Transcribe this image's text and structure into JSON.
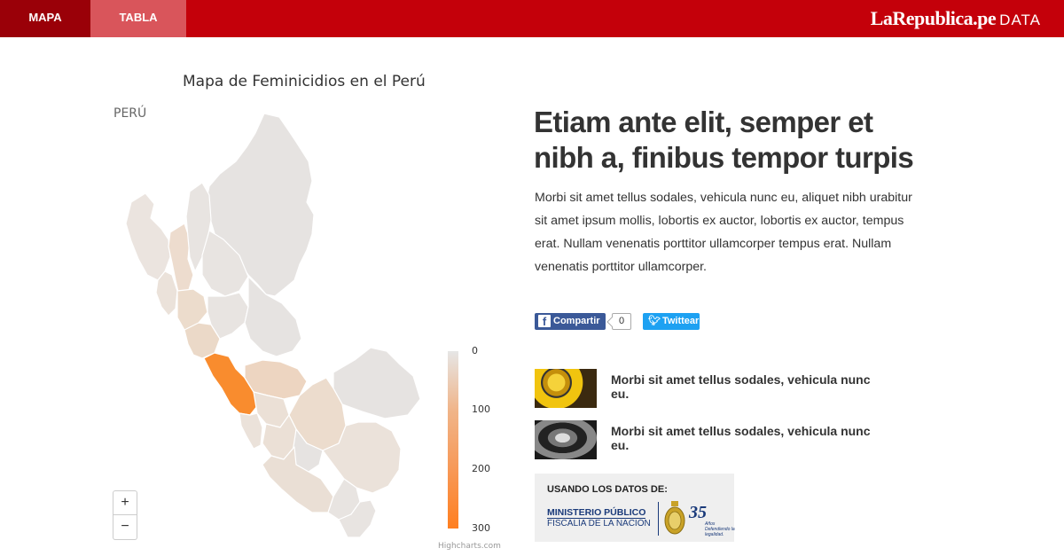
{
  "nav": {
    "tab_mapa": "MAPA",
    "tab_tabla": "TABLA",
    "brand": "LaRepublica.pe",
    "brand_suffix": "DATA"
  },
  "map": {
    "title": "Mapa de Feminicidios en el Perú",
    "subtitle": "PERÚ",
    "legend_ticks": [
      "0",
      "100",
      "200",
      "300"
    ],
    "legend_colors": {
      "min": "#e6e6e6",
      "max": "#ff7f20"
    },
    "highlight_color": "#f98c2e",
    "credits": "Highcharts.com",
    "zoom_in": "+",
    "zoom_out": "−"
  },
  "article": {
    "headline": "Etiam ante elit, semper et nibh a, finibus tempor turpis",
    "body": "Morbi sit amet tellus sodales, vehicula nunc eu, aliquet nibh urabitur sit amet ipsum mollis, lobortis ex auctor, lobortis ex auctor, tempus erat. Nullam venenatis porttitor ullamcorper tempus erat. Nullam venenatis porttitor ullamcorper."
  },
  "share": {
    "facebook_label": "Compartir",
    "facebook_count": "0",
    "twitter_label": "Twittear"
  },
  "related": [
    {
      "title": "Morbi sit amet tellus sodales, vehicula nunc eu."
    },
    {
      "title": "Morbi sit amet tellus sodales, vehicula nunc eu."
    }
  ],
  "source": {
    "heading": "USANDO LOS DATOS DE:",
    "org_line1": "MINISTERIO PÚBLICO",
    "org_line2": "FISCALÍA DE LA NACIÓN",
    "years": "35",
    "motto": "Años Defendiendo la legalidad."
  },
  "colors": {
    "brand_red": "#c4000a",
    "tab_active": "#9a0008",
    "tab_inactive": "#d9555b",
    "facebook": "#3b5998",
    "twitter": "#1da1f2"
  }
}
